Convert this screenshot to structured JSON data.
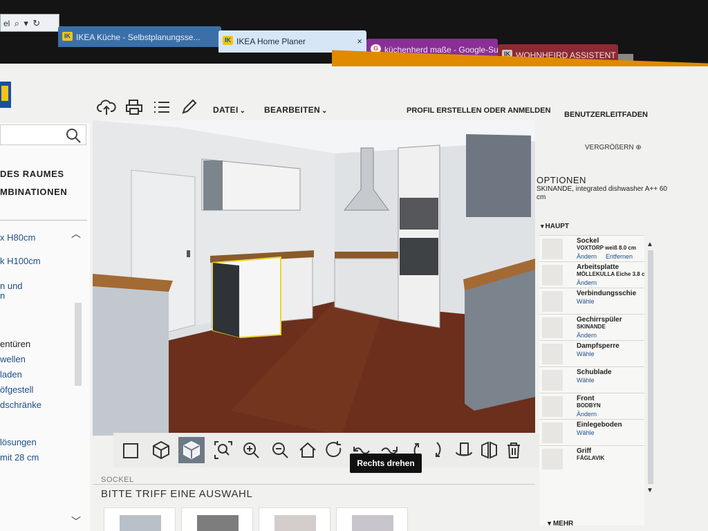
{
  "browser": {
    "address_fragment": "el",
    "tabs": [
      {
        "title": "IKEA Küche - Selbstplanungsse...",
        "icon": "ikea-favicon"
      },
      {
        "title": "IKEA Home Planer",
        "icon": "ikea-favicon",
        "close": "×"
      },
      {
        "title": "küchenherd maße - Google-Su...",
        "icon": "google-favicon"
      },
      {
        "title": "WOHNHEIRD ASSISTENT - ...",
        "icon": "ikea-favicon"
      }
    ]
  },
  "header": {
    "menus": [
      "DATEI",
      "BEARBEITEN"
    ],
    "menu_chevron": "⌄",
    "links": [
      "PROFIL ERSTELLEN ODER ANMELDEN",
      "BENUTZERLEITFADEN"
    ],
    "icons": [
      "upload-cloud-icon",
      "print-icon",
      "list-icon",
      "pencil-icon"
    ]
  },
  "left_panel": {
    "categories": [
      "DES RAUMES",
      "MBINATIONEN"
    ],
    "items": [
      {
        "text": "x H80cm",
        "style": "link"
      },
      {
        "text": "k H100cm",
        "style": "link"
      },
      {
        "text": "n und",
        "style": "link"
      },
      {
        "text": "n",
        "style": "link"
      },
      {
        "text": "entüren",
        "style": "dark"
      },
      {
        "text": "wellen",
        "style": "link"
      },
      {
        "text": "laden",
        "style": "link"
      },
      {
        "text": "öfgestell",
        "style": "link"
      },
      {
        "text": "dschränke",
        "style": "link"
      },
      {
        "text": "lösungen",
        "style": "link"
      },
      {
        "text": "mit 28 cm",
        "style": "link"
      }
    ]
  },
  "viewport": {
    "view_buttons": [
      "2d-view-icon",
      "3d-view-icon",
      "3d-solid-view-icon"
    ],
    "nav_buttons": [
      "zoom-fit-icon",
      "zoom-in-icon",
      "zoom-out-icon",
      "home-icon",
      "rotate-left-icon",
      "turn-left-icon",
      "turn-right-icon",
      "tilt-up-icon",
      "tilt-down-icon",
      "rotate-object-icon",
      "flip-icon",
      "trash-icon"
    ],
    "tooltip": "Rechts drehen"
  },
  "bottom": {
    "section_label": "SOCKEL",
    "heading": "BITTE TRIFF EINE AUSWAHL",
    "swatch_colors": [
      "#b9c0c8",
      "#7d7d7d",
      "#d3cdcc",
      "#c8c6cc"
    ]
  },
  "right_panel": {
    "zoom_link": "VERGRÖßERN",
    "options_title": "OPTIONEN",
    "options_desc": "SKINANDE, integrated dishwasher A++ 60 cm",
    "section": "HAUPT",
    "items": [
      {
        "name": "Sockel",
        "sub": "VOXTORP weiß 8.0 cm",
        "actions": [
          "Ändern",
          "Entfernen"
        ]
      },
      {
        "name": "Arbeitsplatte",
        "sub": "MÖLLEKULLA Eiche 3.8 cm",
        "actions": [
          "Ändern"
        ]
      },
      {
        "name": "Verbindungsschie",
        "sub": "",
        "actions": [
          "Wähle"
        ]
      },
      {
        "name": "Gechirrspüler",
        "sub": "SKINANDE",
        "actions": [
          "Ändern"
        ]
      },
      {
        "name": "Dampfsperre",
        "sub": "",
        "actions": [
          "Wähle"
        ]
      },
      {
        "name": "Schublade",
        "sub": "",
        "actions": [
          "Wähle"
        ]
      },
      {
        "name": "Front",
        "sub": "BODBYN",
        "actions": [
          "Ändern"
        ]
      },
      {
        "name": "Einlegeboden",
        "sub": "",
        "actions": [
          "Wähle"
        ]
      },
      {
        "name": "Griff",
        "sub": "FÅGLAVIK",
        "actions": []
      }
    ],
    "more_link": "MEHR"
  }
}
